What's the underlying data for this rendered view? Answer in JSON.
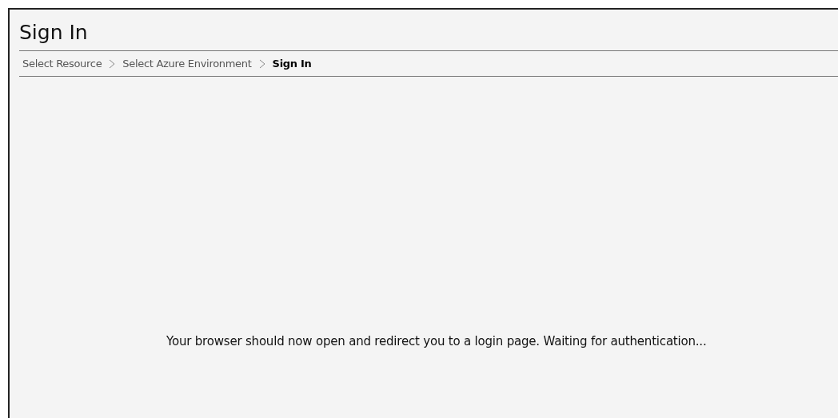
{
  "title": "Sign In",
  "breadcrumb": [
    {
      "label": "Select Resource",
      "selected": false
    },
    {
      "label": "Select Azure Environment",
      "selected": false
    },
    {
      "label": "Sign In",
      "selected": true
    }
  ],
  "message": "Your browser should now open and redirect you to a login page. Waiting for authentication..."
}
